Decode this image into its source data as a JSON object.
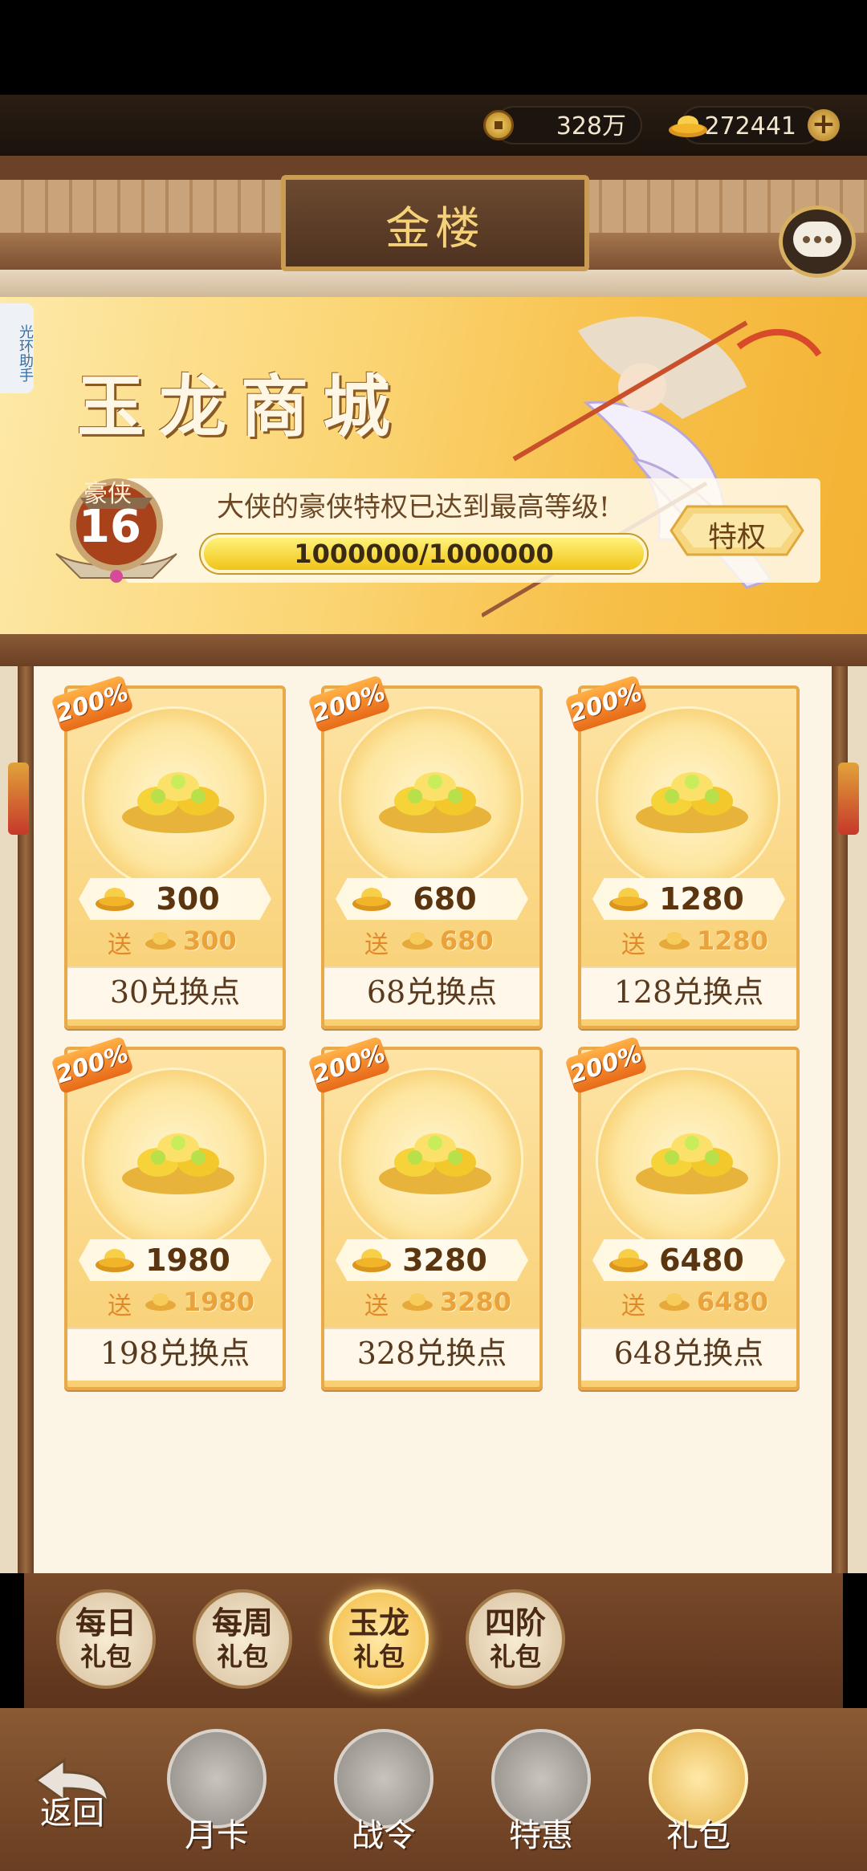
{
  "currency": {
    "coins": "328万",
    "ingots": "272441"
  },
  "header": {
    "title": "金楼",
    "helper_label": "光环助手"
  },
  "banner": {
    "shop_title": "玉龙商城",
    "vip_label": "豪侠",
    "vip_level": "16",
    "privilege_message": "大侠的豪侠特权已达到最高等级!",
    "progress_text": "1000000/1000000",
    "progress_fraction": 1.0,
    "privilege_button": "特权"
  },
  "products": [
    {
      "badge": "200%",
      "amount": "300",
      "bonus_word": "送",
      "bonus": "300",
      "price": "30兑换点",
      "icon": "gold-ingot-small-pile-icon"
    },
    {
      "badge": "200%",
      "amount": "680",
      "bonus_word": "送",
      "bonus": "680",
      "price": "68兑换点",
      "icon": "gold-ingot-tray-icon"
    },
    {
      "badge": "200%",
      "amount": "1280",
      "bonus_word": "送",
      "bonus": "1280",
      "price": "128兑换点",
      "icon": "gold-ingot-sack-icon"
    },
    {
      "badge": "200%",
      "amount": "1980",
      "bonus_word": "送",
      "bonus": "1980",
      "price": "198兑换点",
      "icon": "gold-ingot-red-pouch-icon"
    },
    {
      "badge": "200%",
      "amount": "3280",
      "bonus_word": "送",
      "bonus": "3280",
      "price": "328兑换点",
      "icon": "gold-ingot-chest-icon"
    },
    {
      "badge": "200%",
      "amount": "6480",
      "bonus_word": "送",
      "bonus": "6480",
      "price": "648兑换点",
      "icon": "gold-ingot-large-chest-icon"
    }
  ],
  "tabs": [
    {
      "line1": "每日",
      "line2": "礼包",
      "active": false
    },
    {
      "line1": "每周",
      "line2": "礼包",
      "active": false
    },
    {
      "line1": "玉龙",
      "line2": "礼包",
      "active": true
    },
    {
      "line1": "四阶",
      "line2": "礼包",
      "active": false
    }
  ],
  "nav": {
    "back": "返回",
    "items": [
      {
        "label": "月卡",
        "icon": "month-card-icon",
        "active": false
      },
      {
        "label": "战令",
        "icon": "battle-pass-icon",
        "active": false
      },
      {
        "label": "特惠",
        "icon": "special-offer-icon",
        "active": false
      },
      {
        "label": "礼包",
        "icon": "gift-bag-icon",
        "active": true
      }
    ]
  },
  "colors": {
    "gold": "#f5d27a",
    "card_border": "#e8a94a",
    "brown_frame": "#6a4024"
  }
}
